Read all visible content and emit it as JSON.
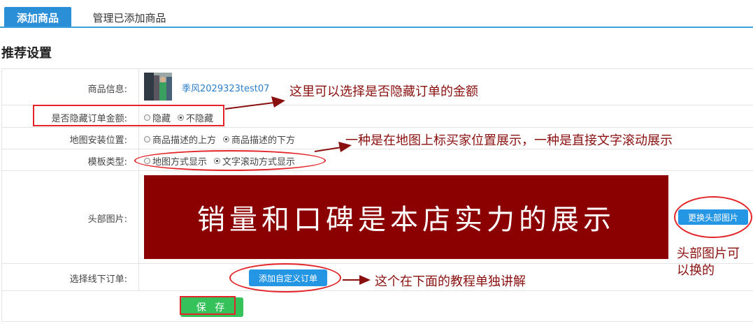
{
  "tabs": {
    "active": "添加商品",
    "other": "管理已添加商品"
  },
  "section_title": "推荐设置",
  "rows": {
    "product_info": {
      "label": "商品信息:",
      "product_name": "季风2029323test07"
    },
    "hide_amount": {
      "label": "是否隐藏订单金额:",
      "options": [
        "隐藏",
        "不隐藏"
      ],
      "selected": "不隐藏"
    },
    "map_position": {
      "label": "地图安装位置:",
      "options": [
        "商品描述的上方",
        "商品描述的下方"
      ],
      "selected": "商品描述的下方"
    },
    "template_type": {
      "label": "模板类型:",
      "options": [
        "地图方式显示",
        "文字滚动方式显示"
      ],
      "selected": "文字滚动方式显示"
    },
    "header_image": {
      "label": "头部图片:",
      "banner_text": "销量和口碑是本店实力的展示",
      "change_button": "更换头部图片"
    },
    "offline_order": {
      "label": "选择线下订单:",
      "add_button": "添加自定义订单"
    }
  },
  "save_button": "保 存",
  "annotations": {
    "hide_amount": "这里可以选择是否隐藏订单的金额",
    "template": "一种是在地图上标买家位置展示，一种是直接文字滚动展示",
    "header_image_line1": "头部图片可",
    "header_image_line2": "以换的",
    "custom_order": "这个在下面的教程单独讲解"
  },
  "colors": {
    "accent": "#2b8fd8",
    "banner": "#8b0000",
    "save": "#35c25a",
    "annotation": "#8a1010",
    "highlight": "#e3252a"
  }
}
